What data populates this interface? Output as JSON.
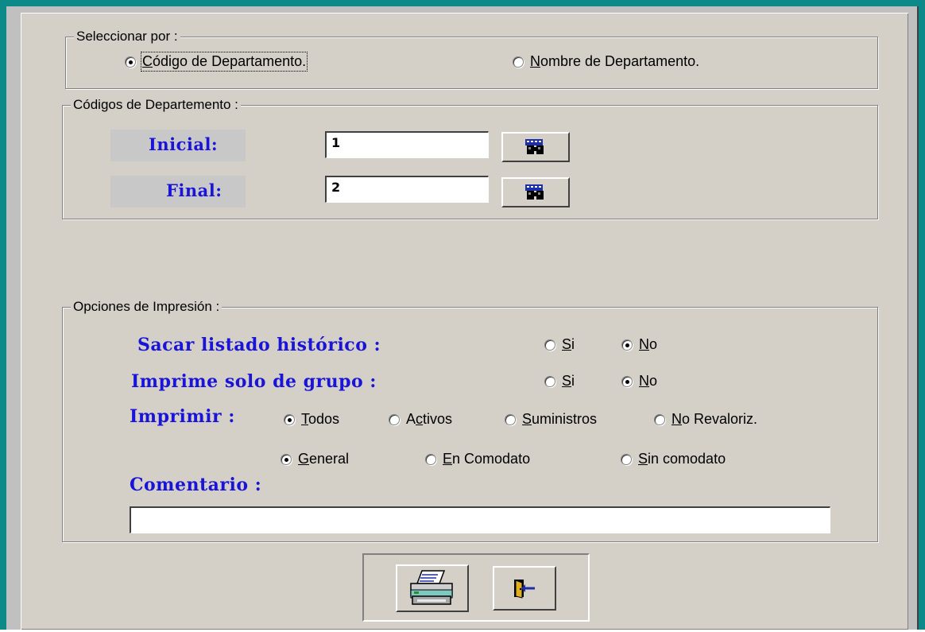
{
  "select_group": {
    "legend": "Seleccionar por :",
    "option_code": {
      "label_u": "C",
      "label_rest": "ódigo de Departamento."
    },
    "option_name": {
      "label_u": "N",
      "label_rest": "ombre de Departamento."
    },
    "selected": "code"
  },
  "codes_group": {
    "legend": "Códigos de Departemento :",
    "initial_label": "Inicial:",
    "initial_value": "1",
    "final_label": "Final:",
    "final_value": "2"
  },
  "print_group": {
    "legend": "Opciones de Impresión :",
    "history_label": "Sacar listado histórico :",
    "history_si": {
      "u": "S",
      "rest": "i"
    },
    "history_no": {
      "u": "N",
      "rest": "o"
    },
    "history_selected": "No",
    "group_label": "Imprime solo de grupo :",
    "group_si": {
      "u": "S",
      "rest": "i"
    },
    "group_no": {
      "u": "N",
      "rest": "o"
    },
    "group_selected": "No",
    "print_label": "Imprimir :",
    "print_options": [
      {
        "u": "T",
        "rest": "odos",
        "selected": true
      },
      {
        "pre": "A",
        "u": "c",
        "rest": "tivos",
        "selected": false
      },
      {
        "u": "S",
        "rest": "uministros",
        "selected": false
      },
      {
        "u": "N",
        "rest": "o Revaloriz.",
        "selected": false
      }
    ],
    "type_options": [
      {
        "u": "G",
        "rest": "eneral",
        "selected": true
      },
      {
        "u": "E",
        "rest": "n Comodato",
        "selected": false
      },
      {
        "u": "S",
        "rest": "in comodato",
        "selected": false
      }
    ],
    "comment_label": "Comentario :",
    "comment_value": ""
  },
  "icons": {
    "search_initial": "binoculars-icon",
    "search_final": "binoculars-icon",
    "print": "printer-icon",
    "exit": "exit-door-icon"
  }
}
